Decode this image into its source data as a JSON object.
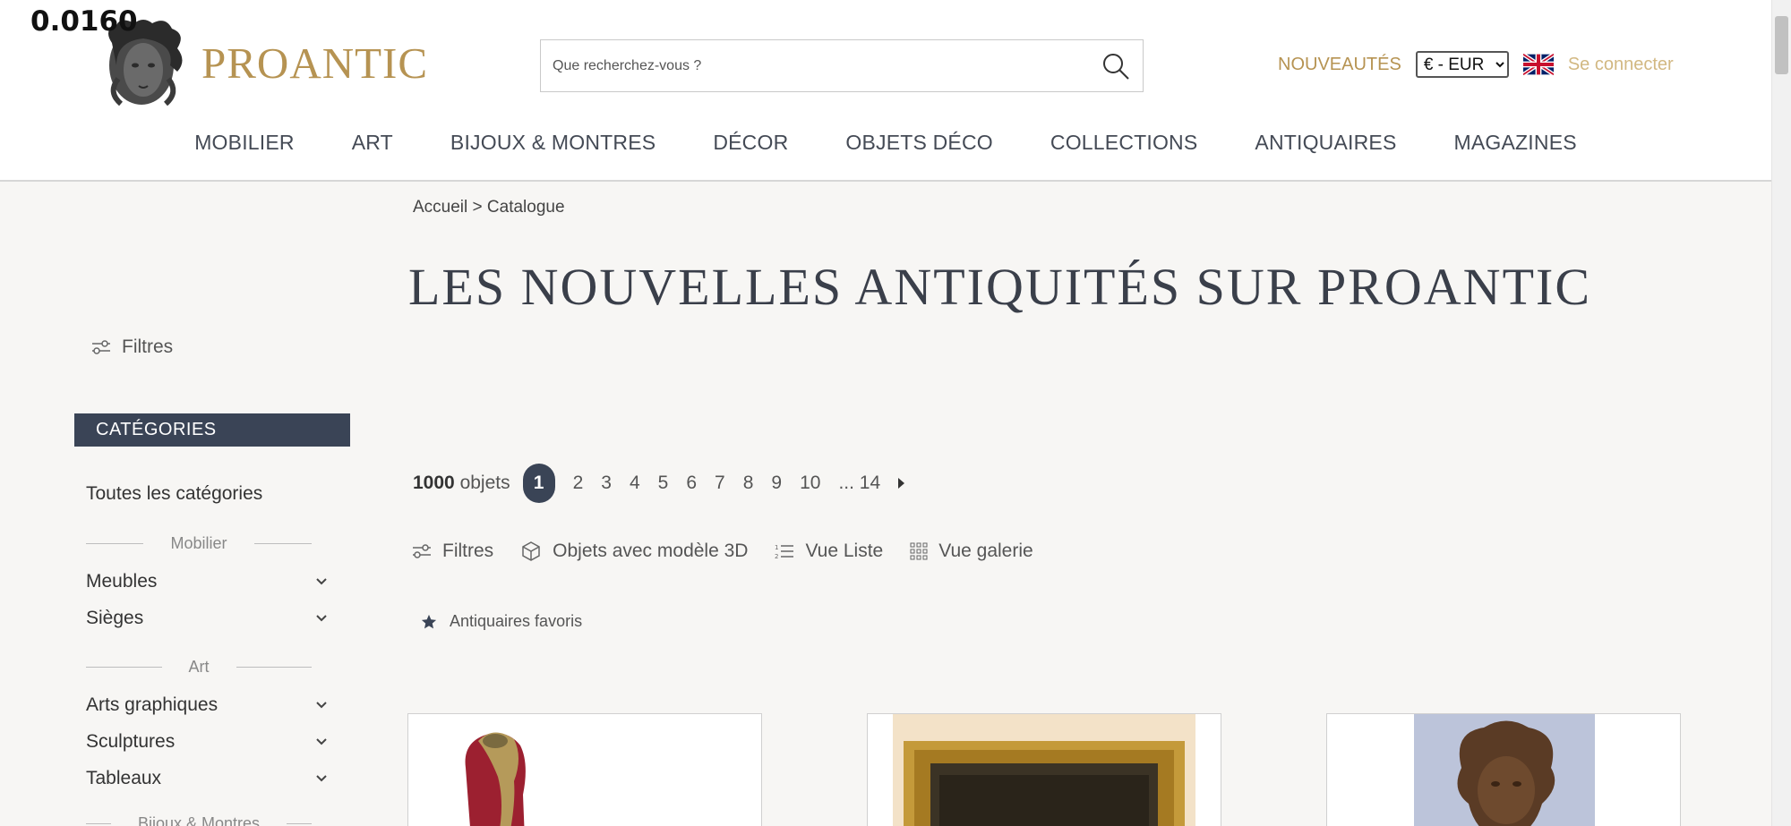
{
  "debug_value": "0.0160",
  "header": {
    "logo_text": "PROANTIC",
    "search_placeholder": "Que recherchez-vous ?",
    "nouveautes": "NOUVEAUTÉS",
    "currency": "€ - EUR",
    "login": "Se connecter"
  },
  "nav": [
    "MOBILIER",
    "ART",
    "BIJOUX & MONTRES",
    "DÉCOR",
    "OBJETS DÉCO",
    "COLLECTIONS",
    "ANTIQUAIRES",
    "MAGAZINES"
  ],
  "breadcrumb": "Accueil > Catalogue",
  "page_title": "LES NOUVELLES ANTIQUITÉS SUR PROANTIC",
  "sidebar": {
    "filters": "Filtres",
    "categories_header": "CATÉGORIES",
    "all_categories": "Toutes les catégories",
    "group_mobilier": "Mobilier",
    "meubles": "Meubles",
    "sieges": "Sièges",
    "group_art": "Art",
    "arts_graphiques": "Arts graphiques",
    "sculptures": "Sculptures",
    "tableaux": "Tableaux",
    "group_bijoux": "Bijoux & Montres"
  },
  "pagination": {
    "count_number": "1000",
    "count_label": "objets",
    "active": "1",
    "pages": [
      "2",
      "3",
      "4",
      "5",
      "6",
      "7",
      "8",
      "9",
      "10"
    ],
    "last": "... 14"
  },
  "toolbar": {
    "filters": "Filtres",
    "objects_3d": "Objets avec modèle 3D",
    "list_view": "Vue Liste",
    "gallery_view": "Vue galerie"
  },
  "favorites": "Antiquaires favoris",
  "colors": {
    "gold": "#b69352",
    "navy": "#3a4456",
    "background": "#f7f6f4"
  }
}
